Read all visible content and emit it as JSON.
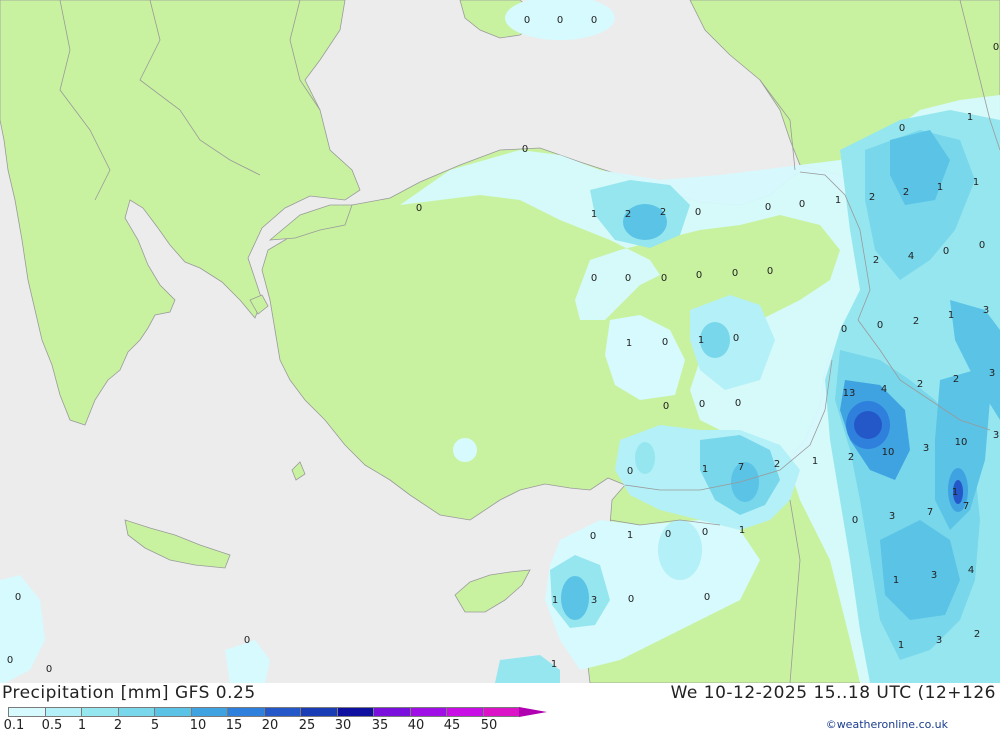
{
  "header": {
    "title": "Precipitation [mm] GFS 0.25",
    "datetime": "We 10-12-2025 15..18 UTC (12+126"
  },
  "legend": {
    "labels": [
      "0.1",
      "0.5",
      "1",
      "2",
      "5",
      "10",
      "15",
      "20",
      "25",
      "30",
      "35",
      "40",
      "45",
      "50"
    ],
    "colors": [
      "#d6fafe",
      "#b4f0f7",
      "#96e6f0",
      "#78d7ea",
      "#5ac3e6",
      "#3fa3e2",
      "#2f7fdc",
      "#2458c8",
      "#1a3cb4",
      "#1010a0",
      "#7a10dc",
      "#a010e6",
      "#c810e6",
      "#dc14c8",
      "#b000b0"
    ]
  },
  "map_colors": {
    "sea": "#ececec",
    "land": "#c8f2a0",
    "border": "#9a9a9a"
  },
  "map_values": [
    "0",
    "0",
    "0",
    "0",
    "0",
    "0",
    "0",
    "1",
    "1",
    "2",
    "0",
    "0",
    "0",
    "1",
    "2",
    "2",
    "1",
    "1",
    "0",
    "0",
    "0",
    "0",
    "0",
    "0",
    "0",
    "2",
    "4",
    "0",
    "0",
    "0",
    "2",
    "1",
    "3",
    "1",
    "0",
    "1",
    "0",
    "13",
    "4",
    "2",
    "2",
    "3",
    "0",
    "0",
    "0",
    "10",
    "3",
    "10",
    "1",
    "7",
    "2",
    "1",
    "2",
    "0",
    "0",
    "1",
    "0",
    "0",
    "1",
    "7",
    "0",
    "3",
    "7",
    "1",
    "3",
    "4",
    "1",
    "3",
    "0",
    "0",
    "1",
    "3",
    "2",
    "1",
    "3",
    "0"
  ],
  "credit": "©weatheronline.co.uk"
}
